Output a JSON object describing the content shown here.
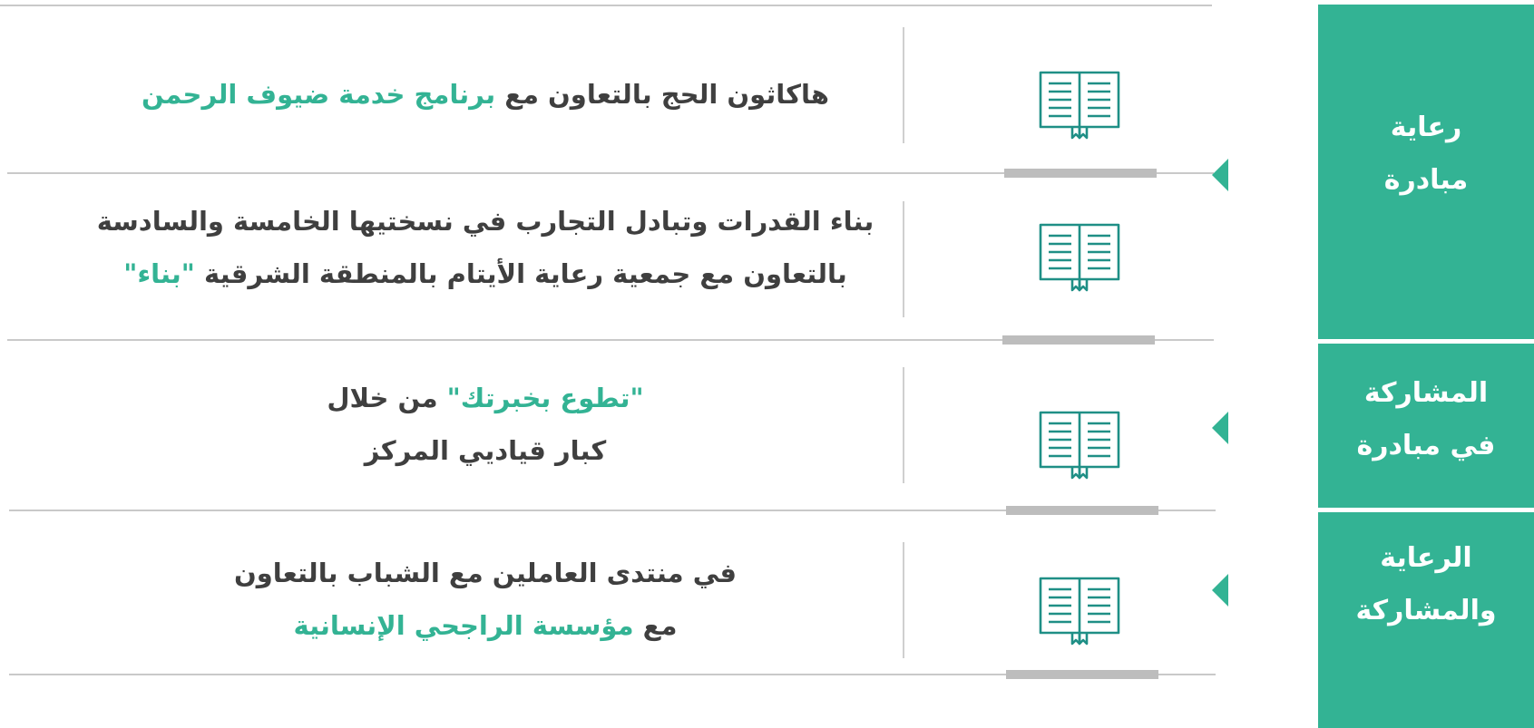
{
  "accent_color": "#33b394",
  "text_color": "#3f3f3f",
  "categories": [
    {
      "line1": "رعاية",
      "line2": "مبادرة"
    },
    {
      "line1": "المشاركة",
      "line2": "في مبادرة"
    },
    {
      "line1": "الرعاية",
      "line2": "والمشاركة"
    }
  ],
  "rows": [
    {
      "icon": "open-book-icon",
      "line1": {
        "before": "هاكاثون الحج بالتعاون مع ",
        "highlight": "برنامج خدمة ضيوف الرحمن",
        "after": ""
      }
    },
    {
      "icon": "open-book-icon",
      "line1": {
        "before": "بناء القدرات وتبادل التجارب في نسختيها الخامسة والسادسة",
        "highlight": "",
        "after": ""
      },
      "line2": {
        "before": "بالتعاون مع جمعية رعاية الأيتام بالمنطقة الشرقية ",
        "highlight": "\"بناء\"",
        "after": ""
      }
    },
    {
      "icon": "open-book-icon",
      "line1": {
        "before": "",
        "highlight": "\"تطوع بخبرتك\"",
        "after": " من خلال"
      },
      "line2": {
        "before": "كبار قياديي المركز",
        "highlight": "",
        "after": ""
      }
    },
    {
      "icon": "open-book-icon",
      "line1": {
        "before": "في منتدى العاملين مع الشباب بالتعاون",
        "highlight": "",
        "after": ""
      },
      "line2": {
        "before": "مع ",
        "highlight": "مؤسسة الراجحي الإنسانية",
        "after": ""
      }
    }
  ]
}
